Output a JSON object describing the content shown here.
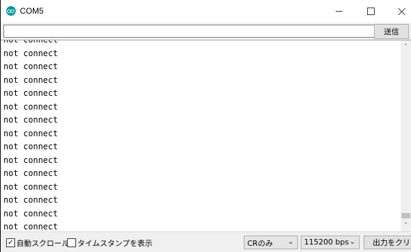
{
  "window": {
    "title": "COM5"
  },
  "send": {
    "input_value": "",
    "button_label": "送信"
  },
  "output": {
    "lines": [
      "not connect",
      "not connect",
      "not connect",
      "not connect",
      "not connect",
      "not connect",
      "not connect",
      "not connect",
      "not connect",
      "not connect",
      "not connect",
      "not connect",
      "not connect",
      "not connect",
      "not connect",
      "not connect",
      "not connect"
    ]
  },
  "status": {
    "autoscroll": {
      "label": "自動スクロール",
      "checked": true,
      "mark": "✓"
    },
    "timestamp": {
      "label": "タイムスタンプを表示",
      "checked": false,
      "mark": ""
    },
    "line_ending": "CRのみ",
    "baud_rate": "115200 bps",
    "clear_label": "出力をクリア"
  },
  "colors": {
    "app_icon": "#00979c"
  }
}
